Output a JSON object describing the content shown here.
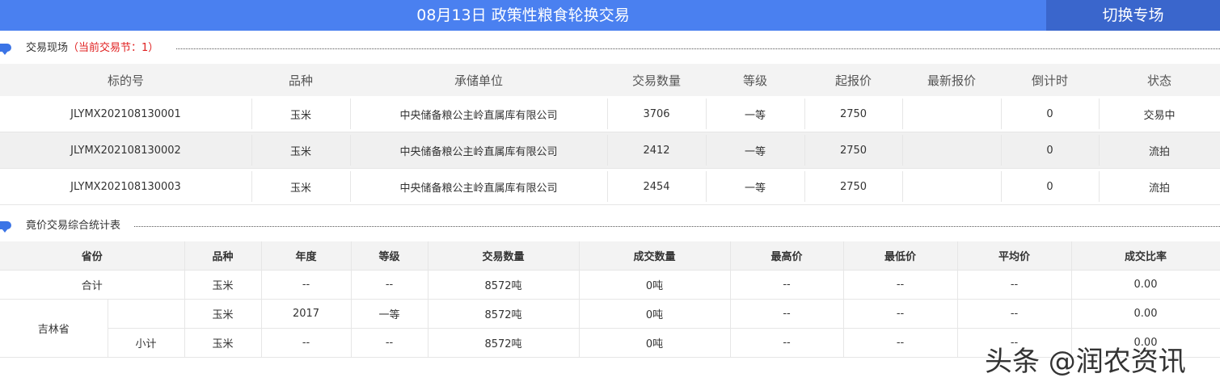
{
  "header": {
    "title": "08月13日 政策性粮食轮换交易",
    "switch_label": "切换专场"
  },
  "section1": {
    "title": "交易现场",
    "subtitle": "（当前交易节：1）"
  },
  "table1": {
    "columns": [
      "标的号",
      "品种",
      "承储单位",
      "交易数量",
      "等级",
      "起报价",
      "最新报价",
      "倒计时",
      "状态"
    ],
    "rows": [
      {
        "lot": "JLYMX202108130001",
        "variety": "玉米",
        "unit": "中央储备粮公主岭直属库有限公司",
        "qty": "3706",
        "grade": "一等",
        "start_price": "2750",
        "latest": "",
        "countdown": "0",
        "status": "交易中"
      },
      {
        "lot": "JLYMX202108130002",
        "variety": "玉米",
        "unit": "中央储备粮公主岭直属库有限公司",
        "qty": "2412",
        "grade": "一等",
        "start_price": "2750",
        "latest": "",
        "countdown": "0",
        "status": "流拍"
      },
      {
        "lot": "JLYMX202108130003",
        "variety": "玉米",
        "unit": "中央储备粮公主岭直属库有限公司",
        "qty": "2454",
        "grade": "一等",
        "start_price": "2750",
        "latest": "",
        "countdown": "0",
        "status": "流拍"
      }
    ]
  },
  "section2": {
    "title": "竟价交易综合统计表"
  },
  "table2": {
    "columns": [
      "省份",
      "品种",
      "年度",
      "等级",
      "交易数量",
      "成交数量",
      "最高价",
      "最低价",
      "平均价",
      "成交比率"
    ],
    "total": {
      "label": "合计",
      "variety": "玉米",
      "year": "--",
      "grade": "--",
      "qty": "8572吨",
      "deal": "0吨",
      "max": "--",
      "min": "--",
      "avg": "--",
      "ratio": "0.00"
    },
    "province": "吉林省",
    "rows": [
      {
        "sub": "",
        "variety": "玉米",
        "year": "2017",
        "grade": "一等",
        "qty": "8572吨",
        "deal": "0吨",
        "max": "--",
        "min": "--",
        "avg": "--",
        "ratio": "0.00"
      },
      {
        "sub": "小计",
        "variety": "玉米",
        "year": "--",
        "grade": "--",
        "qty": "8572吨",
        "deal": "0吨",
        "max": "--",
        "min": "--",
        "avg": "--",
        "ratio": "0.00"
      }
    ]
  },
  "watermark": "头条 @润农资讯",
  "colors": {
    "header_bg": "#4a80f0",
    "switch_bg": "#3a66cc",
    "qty": "#f08030",
    "price": "#5b9bd5",
    "subtitle": "#e02020"
  }
}
